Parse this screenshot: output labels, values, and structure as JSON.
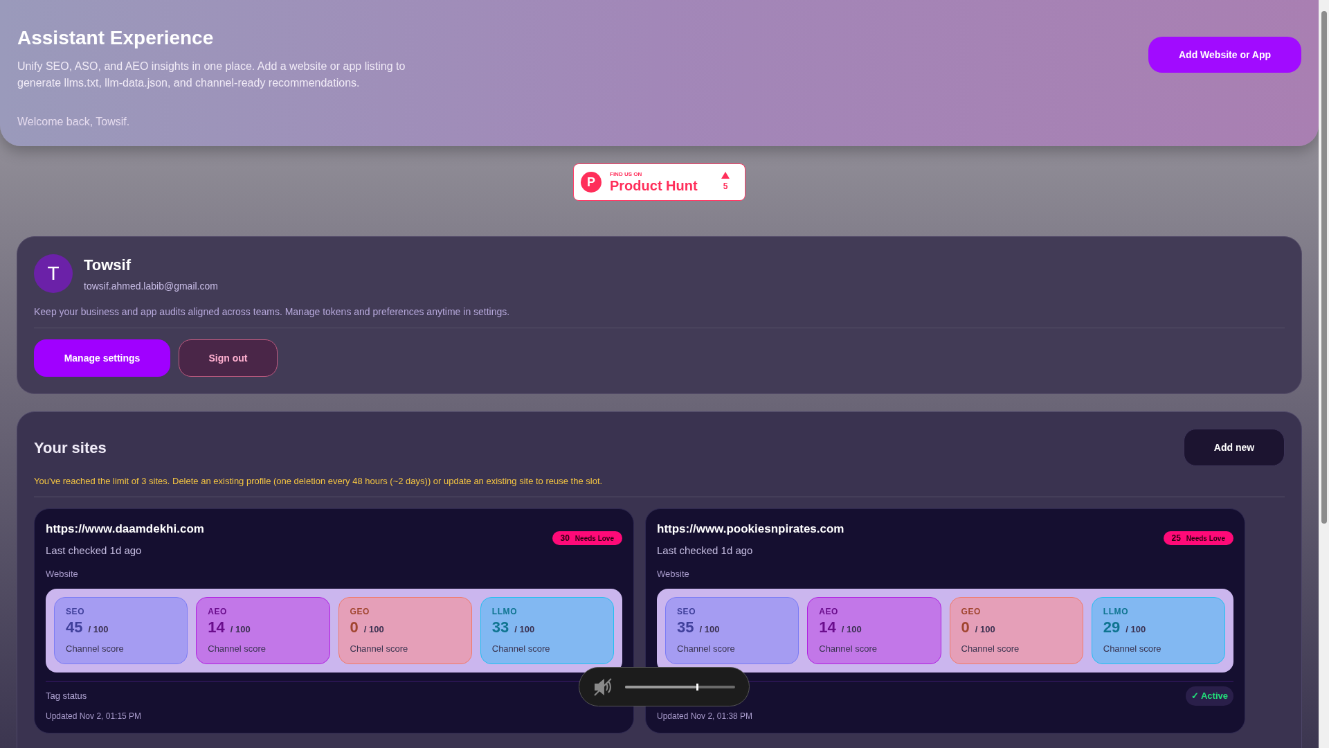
{
  "header": {
    "title": "Assistant Experience",
    "description": "Unify SEO, ASO, and AEO insights in one place. Add a website or app listing to generate llms.txt, llm-data.json, and channel-ready recommendations.",
    "welcome": "Welcome back, Towsif.",
    "button": "Add Website or App"
  },
  "product_hunt": {
    "eyebrow": "FIND US ON",
    "name": "Product Hunt",
    "logo_letter": "P",
    "votes": "5"
  },
  "profile": {
    "initial": "T",
    "name": "Towsif",
    "email": "towsif.ahmed.labib@gmail.com",
    "note": "Keep your business and app audits aligned across teams. Manage tokens and preferences anytime in settings.",
    "buttons": [
      "Manage settings",
      "Sign out"
    ]
  },
  "sites": {
    "title": "Your sites",
    "add_button": "Add new",
    "limit_notice": "You've reached the limit of 3 sites. Delete an existing profile (one deletion every 48 hours (~2 days)) or update an existing site to reuse the slot.",
    "cards": [
      {
        "url": "https://www.daamdekhi.com",
        "last_checked": "Last checked 1d ago",
        "type": "Website",
        "score": "30",
        "score_label": "Needs Love",
        "channels": [
          {
            "kind": "seo",
            "label": "SEO",
            "score": "45",
            "max": "/ 100",
            "caption": "Channel score"
          },
          {
            "kind": "aeo",
            "label": "AEO",
            "score": "14",
            "max": "/ 100",
            "caption": "Channel score"
          },
          {
            "kind": "geo",
            "label": "GEO",
            "score": "0",
            "max": "/ 100",
            "caption": "Channel score"
          },
          {
            "kind": "llmo",
            "label": "LLMO",
            "score": "33",
            "max": "/ 100",
            "caption": "Channel score"
          }
        ],
        "tag_label": "Tag status",
        "updated": "Updated Nov 2, 01:15 PM"
      },
      {
        "url": "https://www.pookiesnpirates.com",
        "last_checked": "Last checked 1d ago",
        "type": "Website",
        "score": "25",
        "score_label": "Needs Love",
        "channels": [
          {
            "kind": "seo",
            "label": "SEO",
            "score": "35",
            "max": "/ 100",
            "caption": "Channel score"
          },
          {
            "kind": "aeo",
            "label": "AEO",
            "score": "14",
            "max": "/ 100",
            "caption": "Channel score"
          },
          {
            "kind": "geo",
            "label": "GEO",
            "score": "0",
            "max": "/ 100",
            "caption": "Channel score"
          },
          {
            "kind": "llmo",
            "label": "LLMO",
            "score": "29",
            "max": "/ 100",
            "caption": "Channel score"
          }
        ],
        "tag_status": "✓ Active",
        "updated": "Updated Nov 2, 01:38 PM"
      }
    ]
  },
  "volume_overlay": {
    "muted": true,
    "level": 0.65
  }
}
